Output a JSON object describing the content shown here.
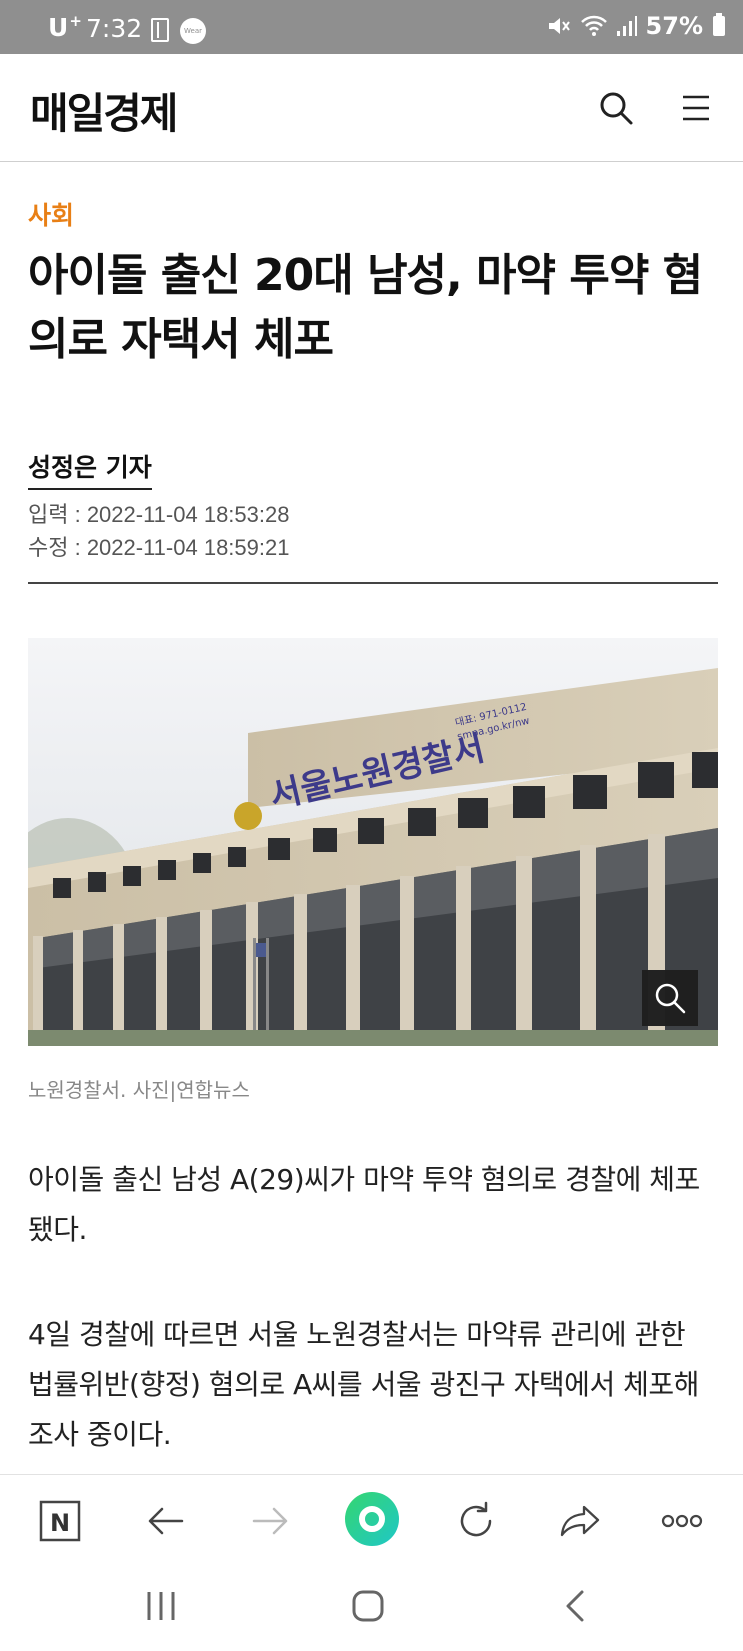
{
  "status_bar": {
    "carrier": "U",
    "carrier_plus": "+",
    "time": "7:32",
    "wear_label": "Wear",
    "battery": "57%"
  },
  "header": {
    "logo": "매일경제"
  },
  "article": {
    "section": "사회",
    "headline": "아이돌 출신 20대 남성, 마약 투약 혐의로 자택서 체포",
    "byline": "성정은 기자",
    "published": "입력 : 2022-11-04 18:53:28",
    "modified": "수정 : 2022-11-04 18:59:21",
    "photo_caption": "노원경찰서. 사진|연합뉴스",
    "paragraphs": [
      "아이돌 출신 남성 A(29)씨가 마약 투약 혐의로 경찰에 체포됐다.",
      "4일 경찰에 따르면 서울 노원경찰서는 마약류 관리에 관한 법률위반(향정) 혐의로 A씨를 서울 광진구 자택에서 체포해 조사 중이다."
    ]
  },
  "photo_sign": {
    "building_name": "서울노원경찰서",
    "sign_small": "대표: 971-0112",
    "sign_small2": "smpa.go.kr/nw"
  },
  "toolbar": {
    "items": [
      "naver-home",
      "back",
      "forward",
      "home",
      "refresh",
      "share",
      "more"
    ],
    "home_label": "N"
  },
  "colors": {
    "section_accent": "#e87f15",
    "status_bar_bg": "#8f8f8f",
    "home_button_gradient": [
      "#35d66f",
      "#1fc7c7"
    ]
  }
}
